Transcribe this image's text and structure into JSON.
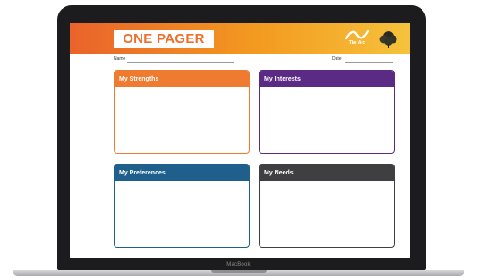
{
  "document": {
    "title": "ONE PAGER",
    "name_label": "Name",
    "date_label": "Date",
    "logo_text": "The Arc"
  },
  "cards": [
    {
      "title": "My Strengths",
      "color": "#ee7b2f"
    },
    {
      "title": "My Interests",
      "color": "#5b2a84"
    },
    {
      "title": "My Preferences",
      "color": "#1f5f8b"
    },
    {
      "title": "My Needs",
      "color": "#3f3f41"
    }
  ],
  "device": {
    "label": "MacBook"
  }
}
